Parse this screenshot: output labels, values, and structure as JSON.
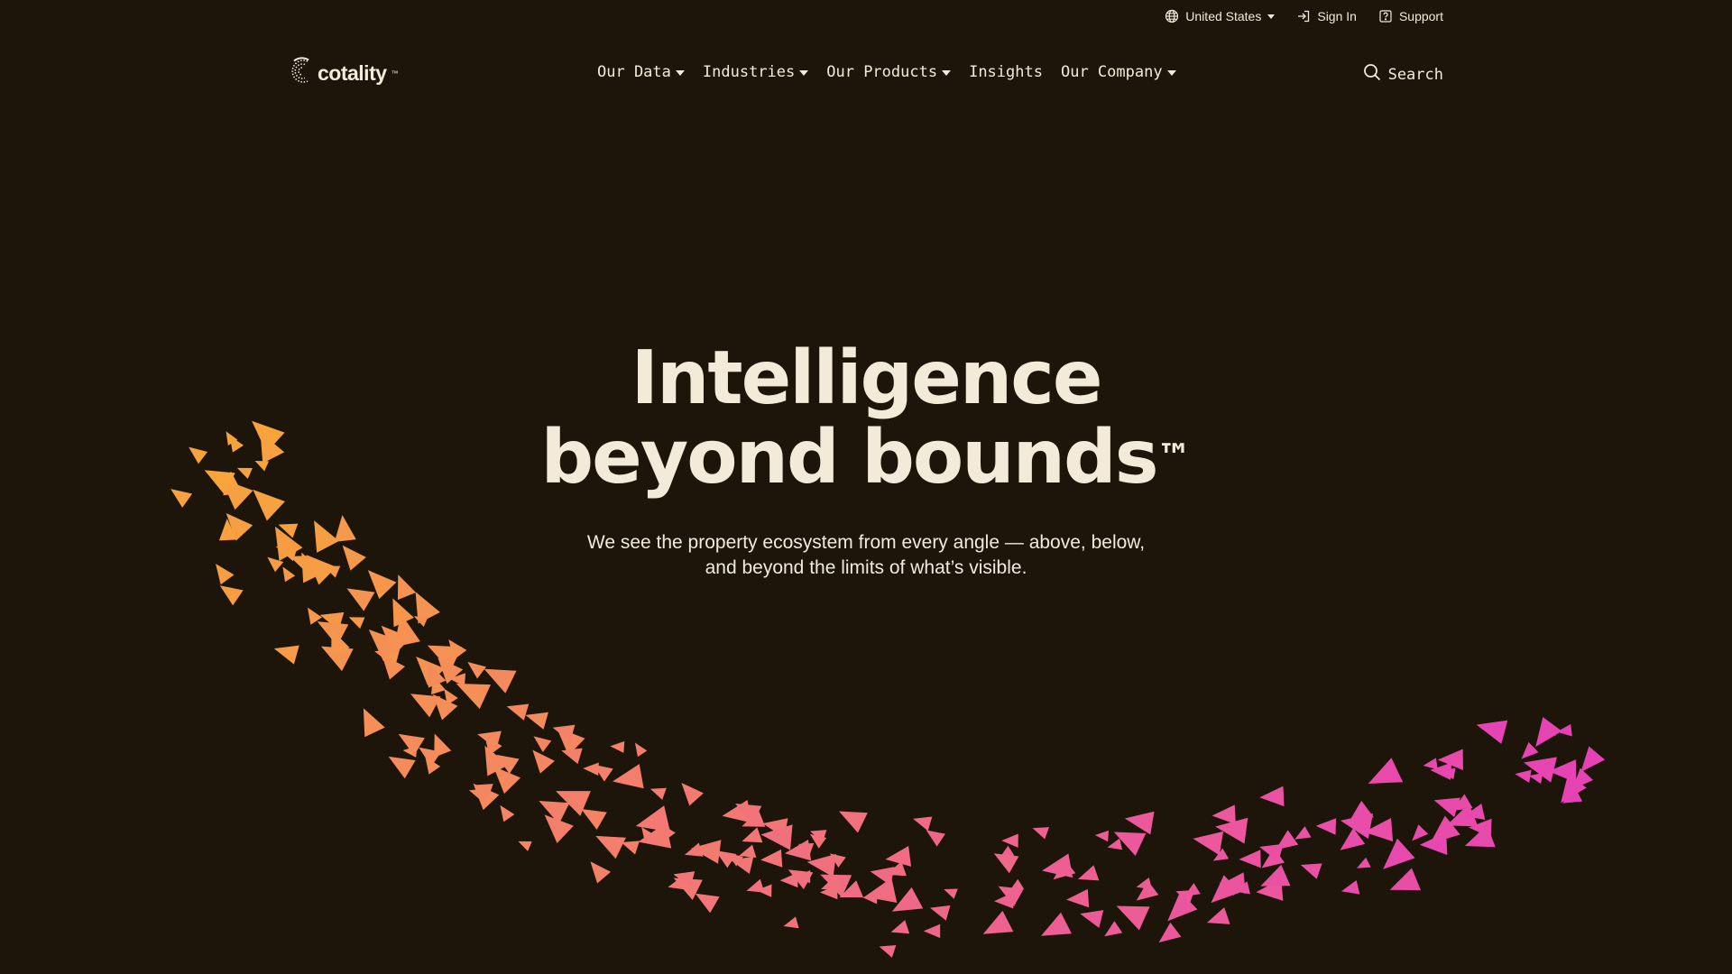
{
  "utility": {
    "region_label": "United States",
    "sign_in_label": "Sign In",
    "support_label": "Support"
  },
  "brand": {
    "name": "cotality",
    "tm": "™"
  },
  "nav": {
    "items": [
      {
        "label": "Our Data",
        "has_dropdown": true
      },
      {
        "label": "Industries",
        "has_dropdown": true
      },
      {
        "label": "Our Products",
        "has_dropdown": true
      },
      {
        "label": "Insights",
        "has_dropdown": false
      },
      {
        "label": "Our Company",
        "has_dropdown": true
      }
    ],
    "search_label": "Search"
  },
  "hero": {
    "title_line1": "Intelligence",
    "title_line2": "beyond bounds",
    "title_tm": "™",
    "subtitle_line1": "We see the property ecosystem from every angle — above, below,",
    "subtitle_line2": "and beyond the limits of what’s visible."
  },
  "colors": {
    "background": "#1d1509",
    "text": "#f3ead9",
    "flock_start": "#f7a53a",
    "flock_mid": "#f2737a",
    "flock_end": "#e540b8"
  }
}
